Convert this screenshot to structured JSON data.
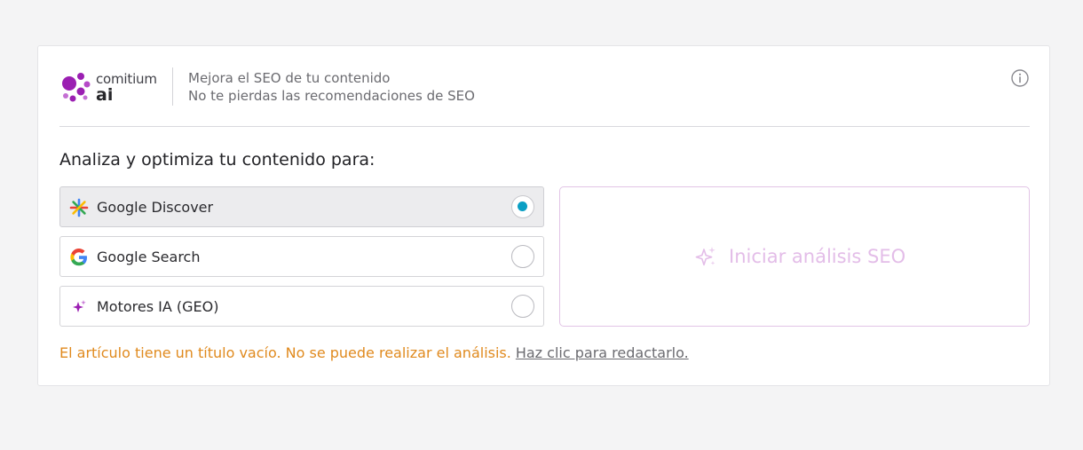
{
  "brand": {
    "name_top": "comitium",
    "name_bottom": "ai",
    "dot_color": "#9b1fb2"
  },
  "header": {
    "subtitle_line1": "Mejora el SEO de tu contenido",
    "subtitle_line2": "No te pierdas las recomendaciones de SEO",
    "info_icon": "info-circle-icon"
  },
  "section": {
    "title": "Analiza y optimiza tu contenido para:"
  },
  "options": [
    {
      "label": "Google Discover",
      "icon": "google-discover-icon",
      "selected": true
    },
    {
      "label": "Google Search",
      "icon": "google-g-icon",
      "selected": false
    },
    {
      "label": "Motores IA (GEO)",
      "icon": "sparkle-icon",
      "selected": false
    }
  ],
  "action": {
    "label": "Iniciar análisis SEO",
    "icon": "sparkle-icon",
    "state": "disabled"
  },
  "warning": {
    "text": "El artículo tiene un título vacío. No se puede realizar el análisis.",
    "link": "Haz clic para redactarlo."
  },
  "colors": {
    "accent_radio": "#0a9fc4",
    "warning": "#e08a1e",
    "disabled_action": "#e3bde8",
    "brand_purple": "#9b1fb2"
  }
}
